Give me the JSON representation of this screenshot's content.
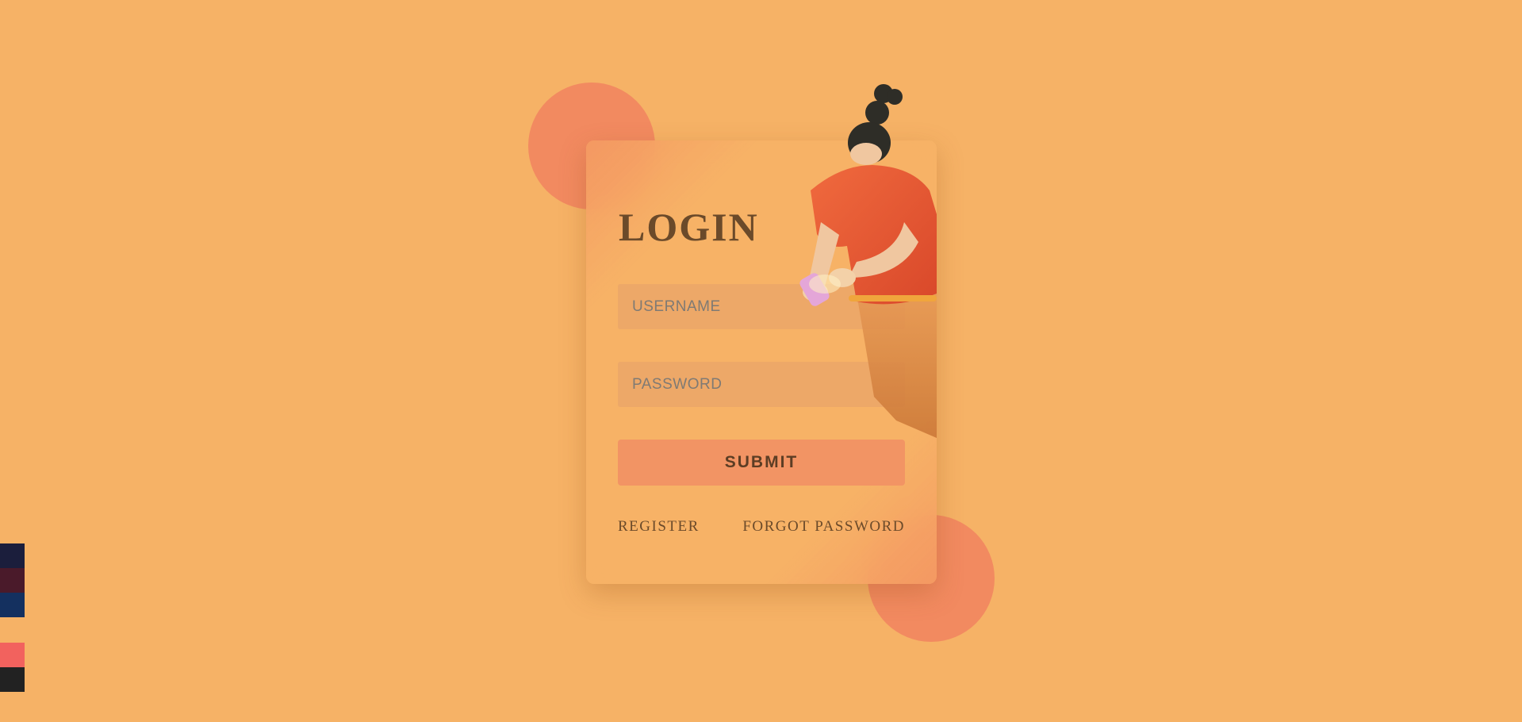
{
  "login": {
    "title": "LOGIN",
    "username_placeholder": "USERNAME",
    "password_placeholder": "PASSWORD",
    "submit_label": "SUBMIT",
    "register_label": "REGISTER",
    "forgot_label": "FORGOT PASSWORD"
  },
  "theme": {
    "background": "#f6b266",
    "accent_circle": "#f28a60",
    "button": "#f29464",
    "text": "#6b4a2a"
  },
  "swatches": [
    "#1b1e3c",
    "#4a1a2a",
    "#14305f",
    "#f2625e",
    "#222222"
  ]
}
